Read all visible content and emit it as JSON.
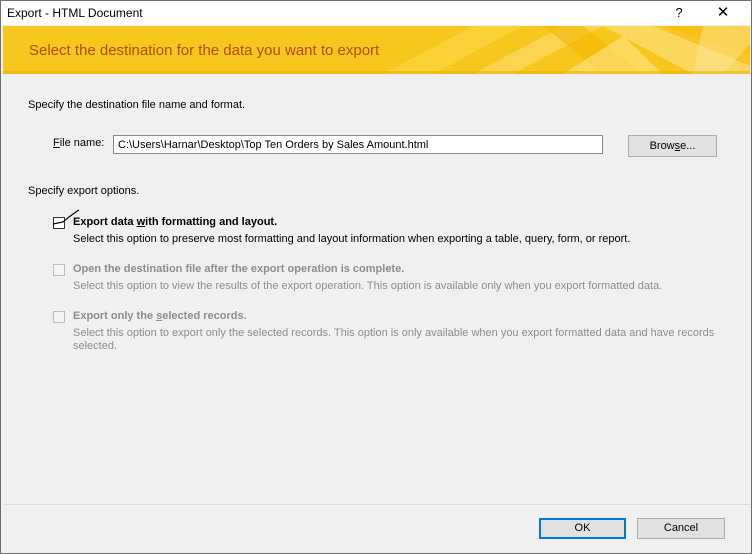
{
  "window": {
    "title": "Export - HTML Document",
    "help_label": "?",
    "close_label": "✕"
  },
  "banner": {
    "heading": "Select the destination for the data you want to export",
    "color": "#f8c71d",
    "text_color": "#b54a00"
  },
  "destination": {
    "hint": "Specify the destination file name and format.",
    "file_label_prefix": "F",
    "file_label_rest": "ile name:",
    "file_value": "C:\\Users\\Harnar\\Desktop\\Top Ten Orders by Sales Amount.html",
    "browse_prefix": "Brow",
    "browse_u": "s",
    "browse_suffix": "e..."
  },
  "options": {
    "hint": "Specify export options.",
    "items": [
      {
        "title_pre": "Export data ",
        "title_u": "w",
        "title_post": "ith formatting and layout.",
        "description": "Select this option to preserve most formatting and layout information when exporting a table, query, form, or report.",
        "enabled": true,
        "checked": false
      },
      {
        "title_pre": "Open the destination file after the export operation is complete.",
        "title_u": "",
        "title_post": "",
        "description": "Select this option to view the results of the export operation. This option is available only when you export formatted data.",
        "enabled": false,
        "checked": false
      },
      {
        "title_pre": "Export only the ",
        "title_u": "s",
        "title_post": "elected records.",
        "description": "Select this option to export only the selected records. This option is only available when you export formatted data and have records selected.",
        "enabled": false,
        "checked": false
      }
    ]
  },
  "footer": {
    "ok_label": "OK",
    "cancel_label": "Cancel",
    "accent": "#0078d7"
  }
}
